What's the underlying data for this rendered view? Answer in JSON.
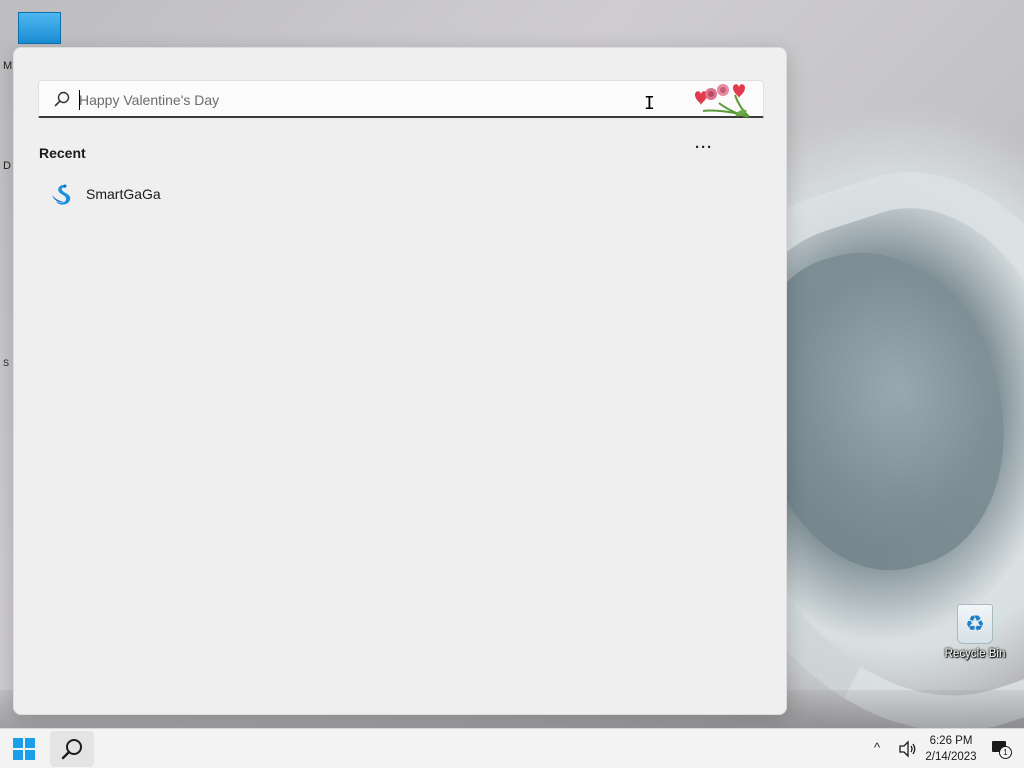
{
  "desktop": {
    "recycle_bin_label": "Recycle Bin",
    "edge_letters": [
      "M",
      "D",
      "S"
    ]
  },
  "search": {
    "placeholder": "Happy Valentine's Day",
    "value": "",
    "recent_label": "Recent",
    "more_label": "···",
    "recent_items": [
      {
        "name": "SmartGaGa",
        "icon": "swan-logo-icon"
      }
    ]
  },
  "taskbar": {
    "time": "6:26 PM",
    "date": "2/14/2023",
    "chevron": "^",
    "notification_count": "1"
  },
  "colors": {
    "accent": "#1a9fe8",
    "flyout_bg": "#efefef",
    "taskbar_bg": "#f3f3f3"
  }
}
